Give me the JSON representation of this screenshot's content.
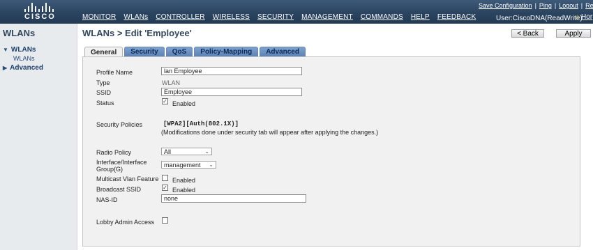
{
  "header": {
    "logo_text": "CISCO",
    "nav": [
      "MONITOR",
      "WLANs",
      "CONTROLLER",
      "WIRELESS",
      "SECURITY",
      "MANAGEMENT",
      "COMMANDS",
      "HELP",
      "FEEDBACK"
    ],
    "util_links": [
      "Save Configuration",
      "Ping",
      "Logout",
      "Refre"
    ],
    "user": "User:CiscoDNA(ReadWrite)",
    "home_label": "Hor"
  },
  "sidebar": {
    "title": "WLANs",
    "groups": [
      {
        "label": "WLANs",
        "expanded": true,
        "children": [
          "WLANs"
        ]
      },
      {
        "label": "Advanced",
        "expanded": false
      }
    ]
  },
  "page": {
    "title": "WLANs > Edit  'Employee'",
    "back_label": "< Back",
    "apply_label": "Apply"
  },
  "tabs": [
    "General",
    "Security",
    "QoS",
    "Policy-Mapping",
    "Advanced"
  ],
  "active_tab": "General",
  "form": {
    "profile_name": {
      "label": "Profile Name",
      "value": "lan Employee"
    },
    "type": {
      "label": "Type",
      "value": "WLAN"
    },
    "ssid": {
      "label": "SSID",
      "value": "Employee"
    },
    "status": {
      "label": "Status",
      "checked": true,
      "text": "Enabled"
    },
    "security_policies": {
      "label": "Security Policies",
      "value": "[WPA2][Auth(802.1X)]",
      "note": "(Modifications done under security tab will appear after applying the changes.)"
    },
    "radio_policy": {
      "label": "Radio Policy",
      "value": "All"
    },
    "interface": {
      "label_line1": "Interface/Interface",
      "label_line2": "Group(G)",
      "value": "management"
    },
    "multicast_vlan": {
      "label": "Multicast Vlan Feature",
      "checked": false,
      "text": "Enabled"
    },
    "broadcast_ssid": {
      "label": "Broadcast SSID",
      "checked": true,
      "text": "Enabled"
    },
    "nas_id": {
      "label": "NAS-ID",
      "value": "none"
    },
    "lobby_admin": {
      "label": "Lobby Admin Access",
      "checked": false
    }
  },
  "colors": {
    "header_bg": "#2b4460",
    "sidebar_bg": "#e8ebee",
    "tab_bg": "#5b82b6",
    "panel_bg": "#f1f1f1",
    "home_icon": "#f3c21c"
  },
  "icons": {
    "logo": "cisco-bridge-bars-icon",
    "expand": "triangle-down-icon",
    "collapse": "triangle-right-icon",
    "home": "home-icon",
    "dropdown": "chevron-down-icon",
    "checkbox_checked": "check-icon"
  }
}
